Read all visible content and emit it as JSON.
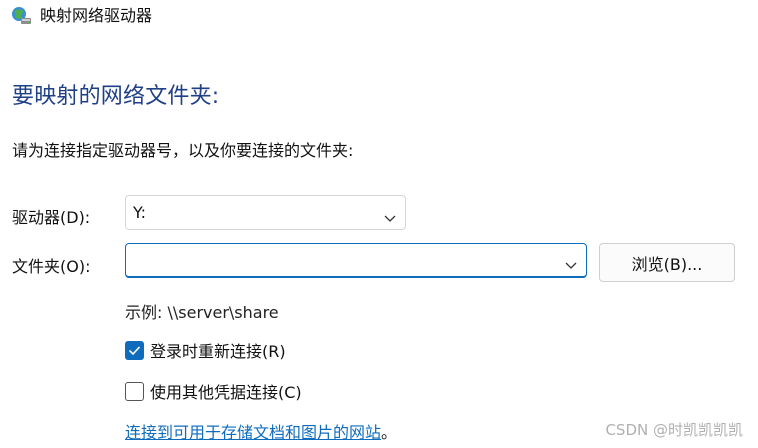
{
  "window": {
    "title": "映射网络驱动器",
    "icon": "network-drive-icon"
  },
  "main": {
    "heading": "要映射的网络文件夹:",
    "instruction": "请为连接指定驱动器号，以及你要连接的文件夹:",
    "drive": {
      "label": "驱动器(D):",
      "value": "Y:"
    },
    "folder": {
      "label": "文件夹(O):",
      "value": ""
    },
    "browse_label": "浏览(B)...",
    "example": "示例: \\\\server\\share",
    "reconnect": {
      "label": "登录时重新连接(R)",
      "checked": true
    },
    "other_credentials": {
      "label": "使用其他凭据连接(C)",
      "checked": false
    },
    "link": {
      "text": "连接到可用于存储文档和图片的网站",
      "suffix": "。"
    }
  },
  "watermark": "CSDN @时凯凯凯凯",
  "colors": {
    "heading": "#1f3f87",
    "accent": "#0f6cbd",
    "watermark": "#b0b0b0"
  }
}
